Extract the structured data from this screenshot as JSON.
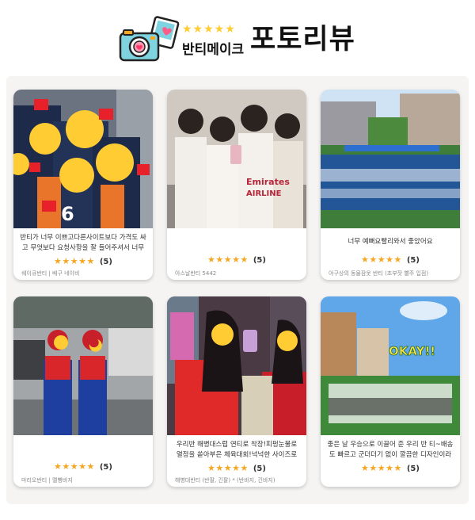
{
  "header": {
    "brand_stars": "★★★★★",
    "brand_name": "반티메이크",
    "title": "포토리뷰"
  },
  "cards": [
    {
      "review": "반티가 너무 이쁘고다른사이트보다 가격도 싸고 무엇보다 요청사항을 잘 들어주셔서 너무 좋…",
      "stars": "★★★★★",
      "score": "(5)",
      "meta": "쉐이큐반티 | 배구 네이비"
    },
    {
      "review": "",
      "stars": "★★★★★",
      "score": "(5)",
      "meta": "아스날반티 5442"
    },
    {
      "review": "너무 예뻐요빨리와서 좋았어요",
      "stars": "★★★★★",
      "score": "(5)",
      "meta": "야구상의 동물잠옷 반티 (초부잣 빨주 입점)"
    },
    {
      "review": "",
      "stars": "★★★★★",
      "score": "(5)",
      "meta": "마리오반티 | 멜빵바지"
    },
    {
      "review": "우리반 해병대스럽 연티로 착장!피펑눈물로 열정을 쏟아부은 체육대회!넉넉한 사이즈로 움직임…",
      "stars": "★★★★★",
      "score": "(5)",
      "meta": "해병대반티 (반팔, 긴팔) * (반바지, 긴바지)"
    },
    {
      "review": "좋은 날 우승으로 이끌어 준 우리 반 티~배송도 빠르고 군더더기 없이 깔끔한 디자인이라 매음에 …",
      "stars": "★★★★★",
      "score": "(5)",
      "meta": "",
      "photo_text": "OKAY!!"
    }
  ]
}
